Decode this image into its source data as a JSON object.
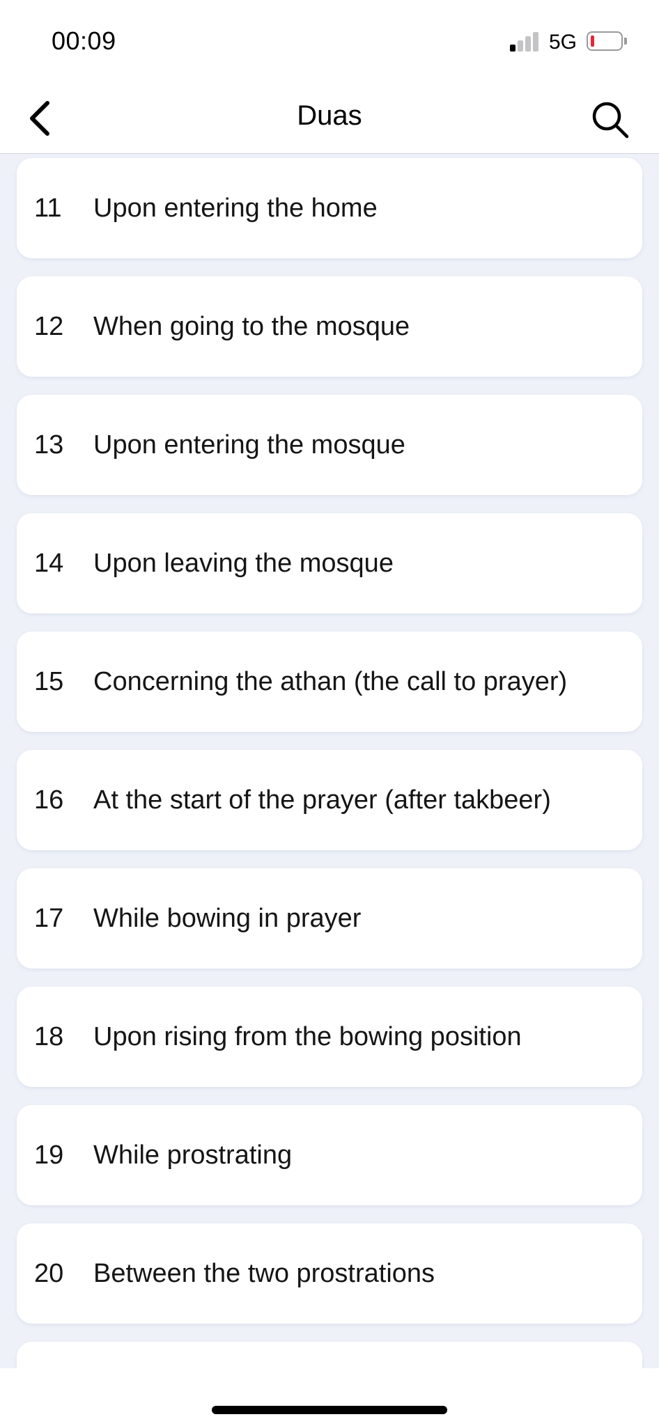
{
  "status_bar": {
    "time": "00:09",
    "network": "5G",
    "icons": {
      "signal": "cellular-signal-icon",
      "battery": "battery-low-icon"
    },
    "battery_color": "#e8263a"
  },
  "nav": {
    "title": "Duas",
    "back_icon": "chevron-left-icon",
    "search_icon": "search-icon"
  },
  "duas": [
    {
      "number": "11",
      "title": "Upon entering the home"
    },
    {
      "number": "12",
      "title": "When going to the mosque"
    },
    {
      "number": "13",
      "title": "Upon entering the mosque"
    },
    {
      "number": "14",
      "title": "Upon leaving the mosque"
    },
    {
      "number": "15",
      "title": "Concerning the athan (the call to prayer)"
    },
    {
      "number": "16",
      "title": "At the start of the prayer (after takbeer)"
    },
    {
      "number": "17",
      "title": "While bowing in prayer"
    },
    {
      "number": "18",
      "title": "Upon rising from the bowing position"
    },
    {
      "number": "19",
      "title": "While prostrating"
    },
    {
      "number": "20",
      "title": "Between the two prostrations"
    }
  ],
  "colors": {
    "background": "#eef1f8",
    "card": "#ffffff",
    "text": "#151515"
  }
}
